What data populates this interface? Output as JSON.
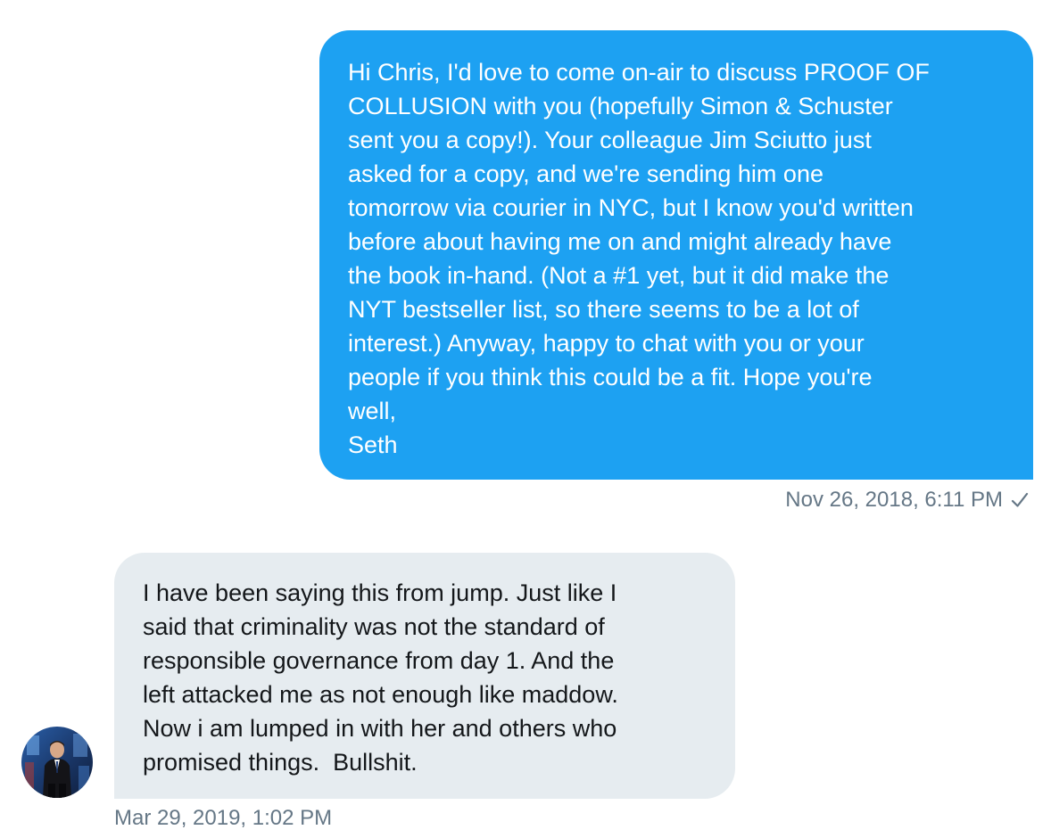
{
  "conversation": {
    "sent_message": {
      "lines": [
        "Hi Chris, I'd love to come on-air to discuss PROOF OF",
        "COLLUSION with you (hopefully Simon & Schuster",
        "sent you a copy!). Your colleague Jim Sciutto just",
        "asked for a copy, and we're sending him one",
        "tomorrow via courier in NYC, but I know you'd written",
        "before about having me on and might already have",
        "the book in-hand. (Not a #1 yet, but it did make the",
        "NYT bestseller list, so there seems to be a lot of",
        "interest.) Anyway, happy to chat with you or your",
        "people if you think this could be a fit. Hope you're",
        "well,",
        "Seth"
      ],
      "timestamp": "Nov 26, 2018, 6:11 PM",
      "status_icon": "checkmark-icon"
    },
    "received_message": {
      "lines": [
        "I have been saying this from jump. Just like I",
        "said that criminality was not the standard of",
        "responsible governance from day 1. And the",
        "left attacked me as not enough like maddow.",
        "Now i am lumped in with her and others who",
        "promised things.  Bullshit."
      ],
      "timestamp": "Mar 29, 2019, 1:02 PM",
      "avatar_icon": "avatar-photo"
    }
  },
  "colors": {
    "sent_bubble": "#1da1f2",
    "received_bubble": "#e6ecf0",
    "meta_text": "#657786"
  }
}
